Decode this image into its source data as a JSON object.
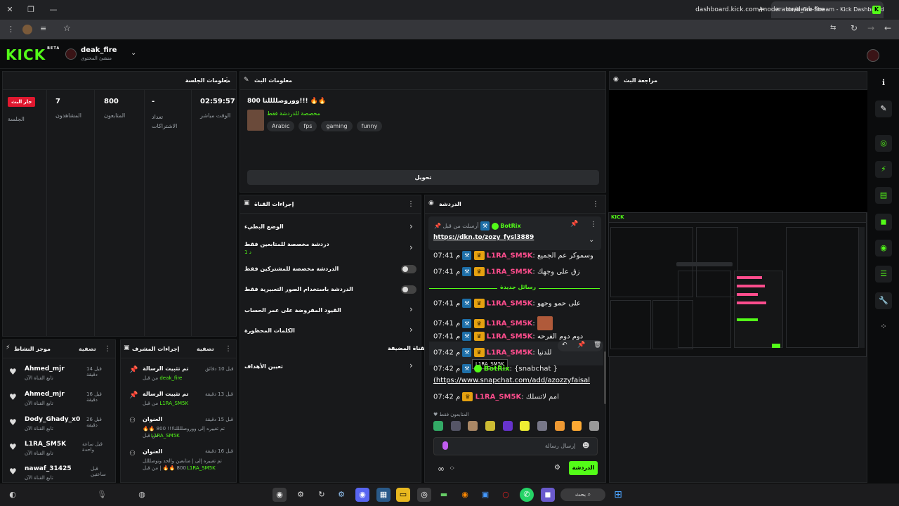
{
  "browser": {
    "tab_title": "deak_fire Stream - Kick Dashboard",
    "url": "dashboard.kick.com/moderator/deak-fire"
  },
  "header": {
    "logo": "KICK",
    "logo_badge": "BETA",
    "channel_name": "deak_fire",
    "channel_role": "منشئ المحتوى"
  },
  "session": {
    "title": "معلومات الجلسة",
    "live_badge": "جار البث",
    "live_label": "الجلسة",
    "viewers_value": "7",
    "viewers_label": "المشاهدون",
    "followers_value": "800",
    "followers_label": "المتابعون",
    "subs_value": "-",
    "subs_label": "تعداد الاشتراكات",
    "uptime_value": "02:59:57",
    "uptime_label": "الوقت مباشر"
  },
  "stream_info": {
    "title": "معلومات البث",
    "stream_title": "800 ووروصللللنا!!! 🔥🔥",
    "category": "مخصصة للدردشة فقط",
    "tags": [
      "Arabic",
      "fps",
      "gaming",
      "funny"
    ],
    "edit_button": "تحويل"
  },
  "preview": {
    "title": "مراجعة البث"
  },
  "channel_actions": {
    "title": "إجراءات القناة",
    "items": [
      {
        "label": "الوضع البطيء",
        "sub": "",
        "control": "chevron"
      },
      {
        "label": "دردشة مخصصة للمتابعين فقط",
        "sub": "1 د",
        "control": "chevron"
      },
      {
        "label": "الدردشة مخصصة للمشتركين فقط",
        "sub": "",
        "control": "toggle"
      },
      {
        "label": "الدردشة باستخدام الصور التعبيرية فقط",
        "sub": "",
        "control": "toggle"
      },
      {
        "label": "القيود المفروضة على عمر الحساب",
        "sub": "",
        "control": "chevron"
      },
      {
        "label": "الكلمات المحظورة",
        "sub": "",
        "control": "chevron"
      }
    ],
    "host_title": "القناة المضيفة",
    "goals_label": "تعيين الأهداف"
  },
  "chat": {
    "title": "الدردشة",
    "pinned": {
      "pinned_by": "أرسلت من قبل",
      "user": "BotRix",
      "link": "https://dkn.to/zozy_fysl3889"
    },
    "new_messages_label": "رسائل جديدة",
    "messages": [
      {
        "time": "07:41 م",
        "user": "L1RA_SM5K",
        "text": "وسموكر عم الجميع"
      },
      {
        "time": "07:41 م",
        "user": "L1RA_SM5K",
        "text": "زق على وجهك"
      },
      {
        "time": "07:41 م",
        "user": "L1RA_SM5K",
        "text": "على حمو وجهو"
      },
      {
        "time": "07:41 م",
        "user": "L1RA_SM5K",
        "text": ""
      },
      {
        "time": "07:41 م",
        "user": "L1RA_SM5K",
        "text": "دوم دوم الفرحه"
      },
      {
        "time": "07:42 م",
        "user": "L1RA_SM5K",
        "text": "للدنيا"
      },
      {
        "time": "07:42 م",
        "user": "BotRix",
        "text": "{snabchat }"
      },
      {
        "time": "07:42 م",
        "user": "L1RA_SM5K",
        "text": "امم لاتسلك"
      }
    ],
    "botrix_link": "(https://www.snapchat.com/add/azozzyfaisal",
    "tooltip": "L1RA_SM5K",
    "followers_only": "المتابعون فقط",
    "input_placeholder": "إرسال رسالة",
    "send_button": "الدردشة"
  },
  "activity": {
    "title": "موجز النشاط",
    "filter": "تصفية",
    "items": [
      {
        "user": "Ahmed_mjr",
        "desc": "تابع القناة الآن",
        "time": "قبل 14 دقيقة"
      },
      {
        "user": "Ahmed_mjr",
        "desc": "تابع القناة الآن",
        "time": "قبل 16 دقيقة"
      },
      {
        "user": "Dody_Ghady_x0",
        "desc": "تابع القناة الآن",
        "time": "قبل 26 دقيقة"
      },
      {
        "user": "L1RA_SM5K",
        "desc": "تابع القناة الآن",
        "time": "قبل ساعة واحدة"
      },
      {
        "user": "nawaf_31425",
        "desc": "تابع القناة الآن",
        "time": "قبل ساعتين"
      }
    ]
  },
  "mod_actions": {
    "title": "إجراءات المشرف",
    "filter": "تصفية",
    "items": [
      {
        "action": "تم تثبيت الرسالة",
        "detail": "من قبل",
        "by": "deak_fire",
        "time": "قبل 10 دقائق",
        "icon": "pin"
      },
      {
        "action": "تم تثبيت الرسالة",
        "detail": "من قبل",
        "by": "L1RA_SM5K",
        "time": "قبل 13 دقيقة",
        "icon": "pin"
      },
      {
        "action": "العنوان",
        "detail": "تم تغييره إلى ووروصللللنا!!! 800 🔥🔥 من قبل",
        "by": "L1RA_SM5K",
        "time": "قبل 15 دقيقة",
        "icon": "person"
      },
      {
        "action": "العنوان",
        "detail": "تم تغييره إلى | متابعين والحد ونوصلللل 800 🔥🔥 | من قبل",
        "by": "L1RA_SM5K",
        "time": "قبل 16 دقيقة",
        "icon": "person"
      }
    ]
  },
  "taskbar": {
    "search_label": "بحث"
  }
}
